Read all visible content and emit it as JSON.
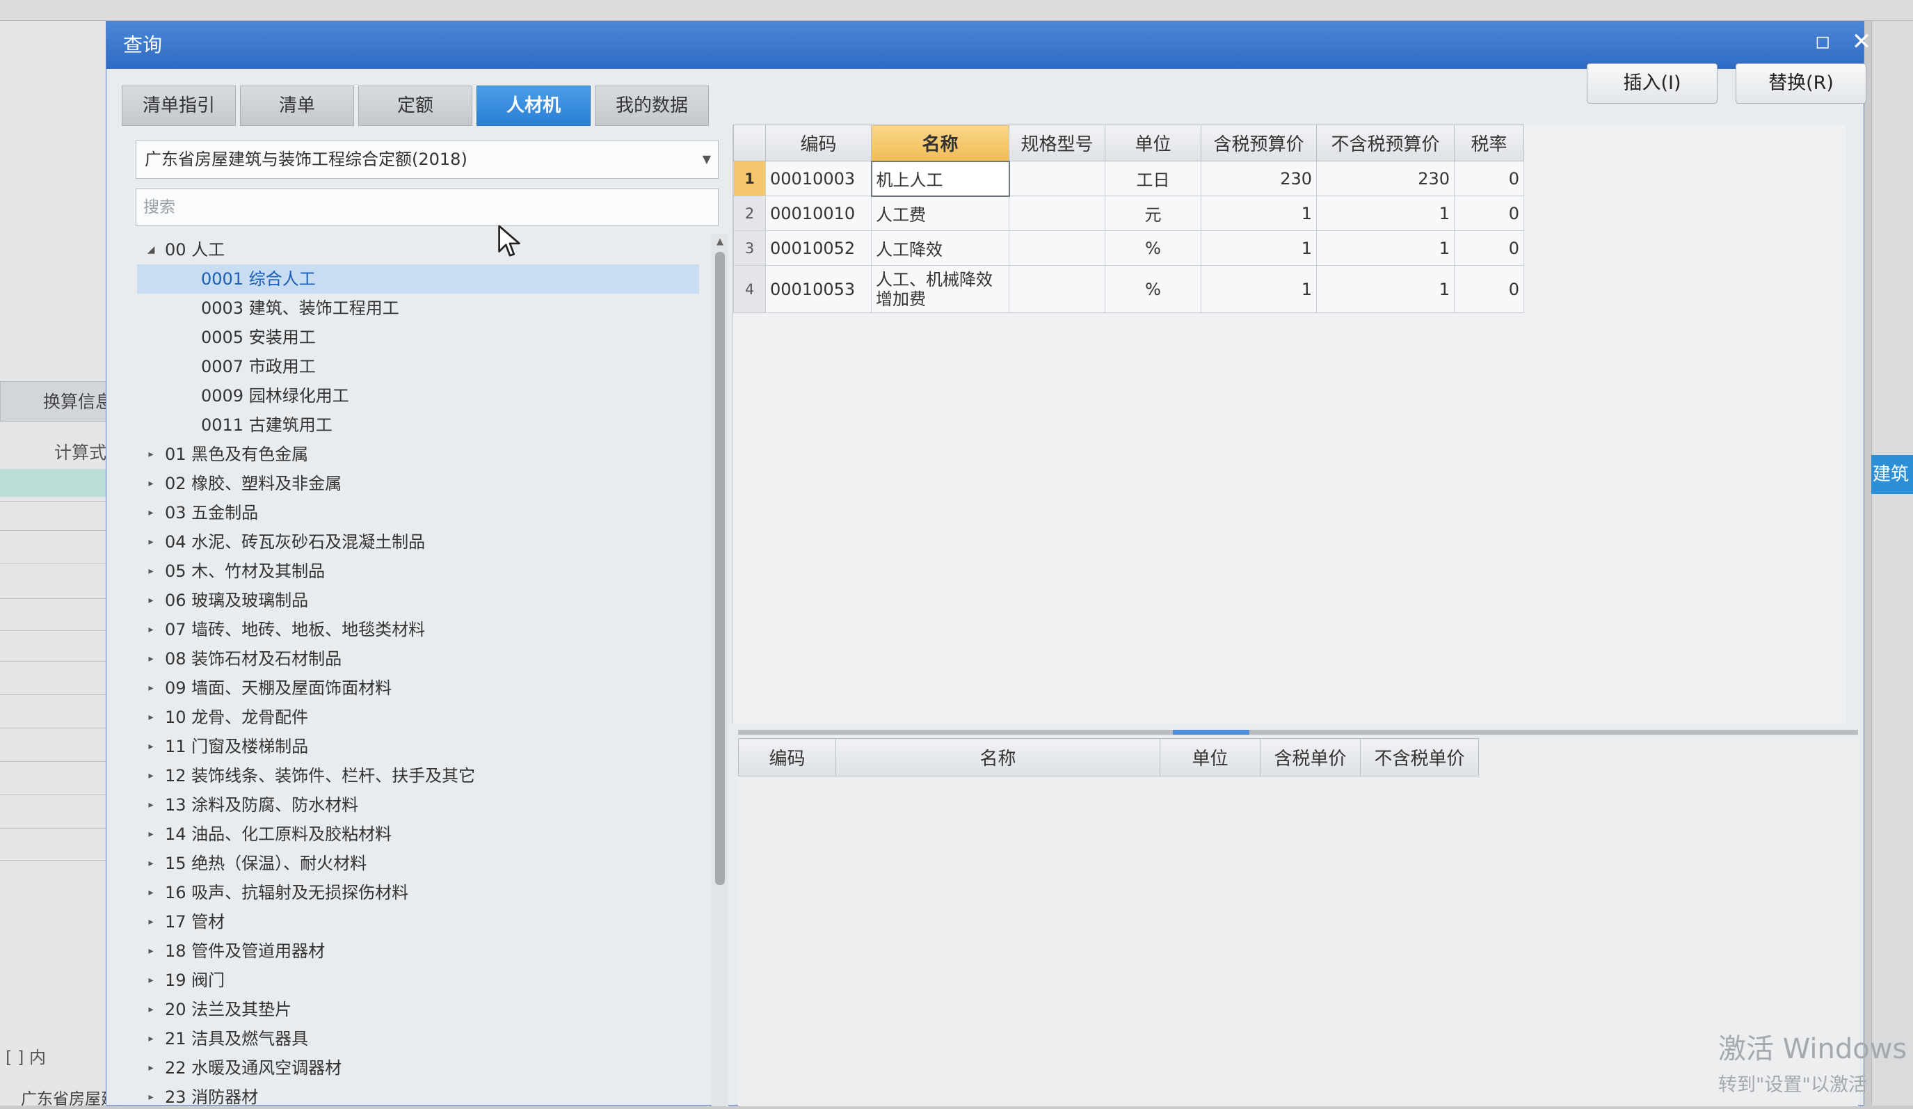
{
  "background": {
    "calc_tab": "换算信息",
    "formula_label": "计算式",
    "bottom_brackets": "[ ]  内",
    "bottom_text": "广东省房屋建筑",
    "right_label": "建筑"
  },
  "dialog": {
    "title": "查询",
    "insert_label": "插入(I)",
    "replace_label": "替换(R)"
  },
  "tabs": [
    "清单指引",
    "清单",
    "定额",
    "人材机",
    "我的数据"
  ],
  "library": "广东省房屋建筑与装饰工程综合定额(2018)",
  "search_placeholder": "搜索",
  "tree": [
    {
      "label": "00 人工",
      "state": "expanded",
      "level": 0
    },
    {
      "label": "0001 综合人工",
      "state": "leaf",
      "level": 1,
      "selected": true
    },
    {
      "label": "0003 建筑、装饰工程用工",
      "state": "leaf",
      "level": 1
    },
    {
      "label": "0005 安装用工",
      "state": "leaf",
      "level": 1
    },
    {
      "label": "0007 市政用工",
      "state": "leaf",
      "level": 1
    },
    {
      "label": "0009 园林绿化用工",
      "state": "leaf",
      "level": 1
    },
    {
      "label": "0011 古建筑用工",
      "state": "leaf",
      "level": 1
    },
    {
      "label": "01 黑色及有色金属",
      "state": "collapsed",
      "level": 0
    },
    {
      "label": "02 橡胶、塑料及非金属",
      "state": "collapsed",
      "level": 0
    },
    {
      "label": "03 五金制品",
      "state": "collapsed",
      "level": 0
    },
    {
      "label": "04 水泥、砖瓦灰砂石及混凝土制品",
      "state": "collapsed",
      "level": 0
    },
    {
      "label": "05 木、竹材及其制品",
      "state": "collapsed",
      "level": 0
    },
    {
      "label": "06 玻璃及玻璃制品",
      "state": "collapsed",
      "level": 0
    },
    {
      "label": "07 墙砖、地砖、地板、地毯类材料",
      "state": "collapsed",
      "level": 0
    },
    {
      "label": "08 装饰石材及石材制品",
      "state": "collapsed",
      "level": 0
    },
    {
      "label": "09 墙面、天棚及屋面饰面材料",
      "state": "collapsed",
      "level": 0
    },
    {
      "label": "10 龙骨、龙骨配件",
      "state": "collapsed",
      "level": 0
    },
    {
      "label": "11 门窗及楼梯制品",
      "state": "collapsed",
      "level": 0
    },
    {
      "label": "12 装饰线条、装饰件、栏杆、扶手及其它",
      "state": "collapsed",
      "level": 0
    },
    {
      "label": "13 涂料及防腐、防水材料",
      "state": "collapsed",
      "level": 0
    },
    {
      "label": "14 油品、化工原料及胶粘材料",
      "state": "collapsed",
      "level": 0
    },
    {
      "label": "15 绝热（保温）、耐火材料",
      "state": "collapsed",
      "level": 0
    },
    {
      "label": "16 吸声、抗辐射及无损探伤材料",
      "state": "collapsed",
      "level": 0
    },
    {
      "label": "17 管材",
      "state": "collapsed",
      "level": 0
    },
    {
      "label": "18 管件及管道用器材",
      "state": "collapsed",
      "level": 0
    },
    {
      "label": "19 阀门",
      "state": "collapsed",
      "level": 0
    },
    {
      "label": "20 法兰及其垫片",
      "state": "collapsed",
      "level": 0
    },
    {
      "label": "21 洁具及燃气器具",
      "state": "collapsed",
      "level": 0
    },
    {
      "label": "22 水暖及通风空调器材",
      "state": "collapsed",
      "level": 0
    },
    {
      "label": "23 消防器材",
      "state": "collapsed",
      "level": 0
    }
  ],
  "grid": {
    "columns": [
      "编码",
      "名称",
      "规格型号",
      "单位",
      "含税预算价",
      "不含税预算价",
      "税率"
    ],
    "sorted_column": "名称",
    "rows": [
      {
        "no": "1",
        "code": "00010003",
        "name": "机上人工",
        "spec": "",
        "unit": "工日",
        "price_tax": "230",
        "price_notax": "230",
        "rate": "0"
      },
      {
        "no": "2",
        "code": "00010010",
        "name": "人工费",
        "spec": "",
        "unit": "元",
        "price_tax": "1",
        "price_notax": "1",
        "rate": "0"
      },
      {
        "no": "3",
        "code": "00010052",
        "name": "人工降效",
        "spec": "",
        "unit": "%",
        "price_tax": "1",
        "price_notax": "1",
        "rate": "0"
      },
      {
        "no": "4",
        "code": "00010053",
        "name": "人工、机械降效增加费",
        "spec": "",
        "unit": "%",
        "price_tax": "1",
        "price_notax": "1",
        "rate": "0"
      }
    ]
  },
  "bottom_grid": {
    "columns": [
      "编码",
      "名称",
      "单位",
      "含税单价",
      "不含税单价"
    ]
  },
  "watermark": {
    "line1": "激活 Windows",
    "line2": "转到\"设置\"以激活"
  }
}
